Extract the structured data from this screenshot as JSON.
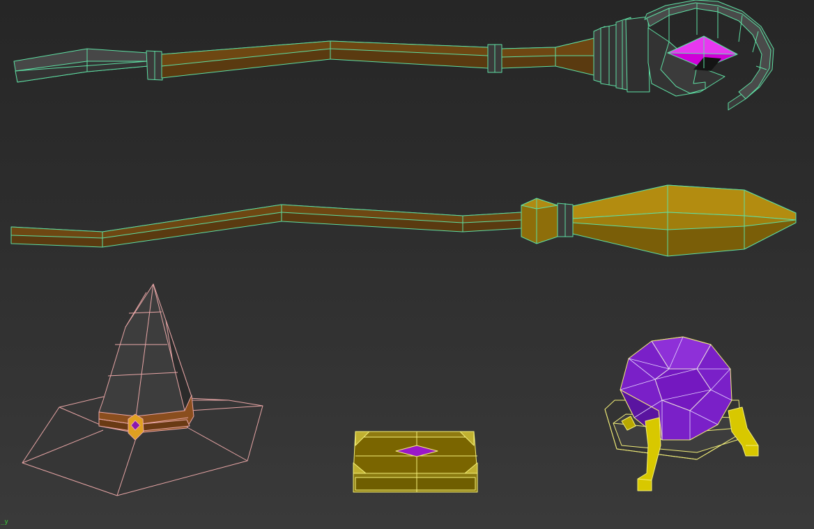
{
  "viewport": {
    "axis_indicator": "_y",
    "colors": {
      "background_top": "#262626",
      "background_bottom": "#3a3a3a",
      "selected_wire": "#5fe0a4",
      "hat_wire": "#e8a6a6",
      "prop_wire": "#f4f07a",
      "axis_text": "#3cd23c"
    }
  },
  "scene_objects": [
    {
      "name": "staff",
      "icon": "staff-mesh",
      "material_colors": [
        "#3b3b3b",
        "#6b4210",
        "#e000e0"
      ]
    },
    {
      "name": "broom",
      "icon": "broom-mesh",
      "material_colors": [
        "#6b4210",
        "#b08a12",
        "#3b3b3b"
      ]
    },
    {
      "name": "witch-hat",
      "icon": "hat-mesh",
      "material_colors": [
        "#3b3b3b",
        "#8a4e1e",
        "#e0a020",
        "#8a18b0"
      ]
    },
    {
      "name": "spell-book",
      "icon": "book-mesh",
      "material_colors": [
        "#7a6300",
        "#8f7a10",
        "#9a18c8"
      ]
    },
    {
      "name": "crystal-ball",
      "icon": "crystal-ball-mesh",
      "material_colors": [
        "#7a20c8",
        "#3a3a3a",
        "#d8c800"
      ]
    }
  ]
}
